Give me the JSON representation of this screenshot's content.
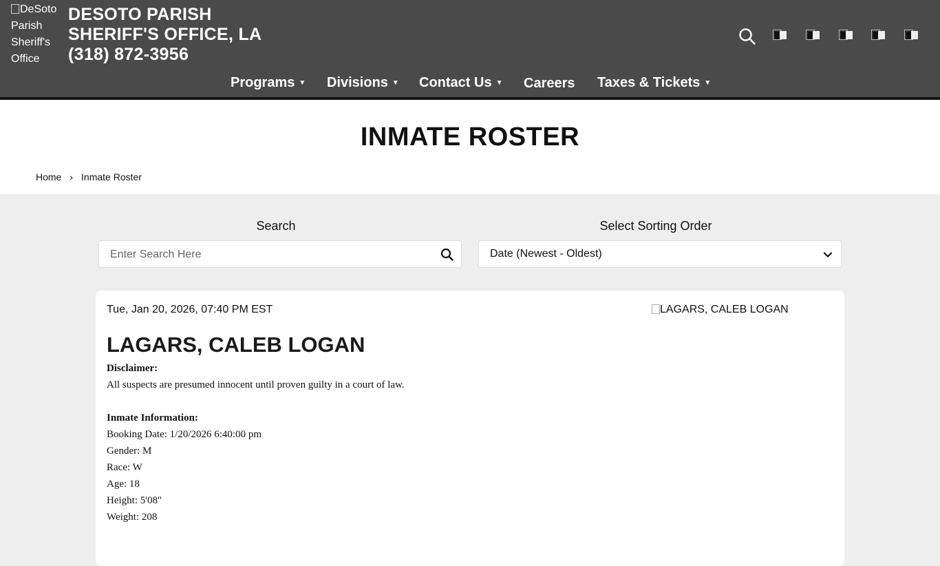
{
  "header": {
    "logo_alt": "DeSoto Parish Sheriff's Office",
    "title_lines": [
      "DESOTO PARISH",
      "SHERIFF'S OFFICE, LA",
      "(318) 872-3956"
    ],
    "social_icons": [
      "social-icon-1",
      "social-icon-2",
      "social-icon-3",
      "social-icon-4",
      "social-icon-5"
    ]
  },
  "nav": {
    "items": [
      {
        "label": "Programs",
        "has_dropdown": true
      },
      {
        "label": "Divisions",
        "has_dropdown": true
      },
      {
        "label": "Contact Us",
        "has_dropdown": true
      },
      {
        "label": "Careers",
        "has_dropdown": false
      },
      {
        "label": "Taxes & Tickets",
        "has_dropdown": true
      }
    ],
    "caret": "▼"
  },
  "page": {
    "title": "INMATE ROSTER",
    "breadcrumb": {
      "home": "Home",
      "separator": "›",
      "current": "Inmate Roster"
    }
  },
  "filters": {
    "search_label": "Search",
    "search_placeholder": "Enter Search Here",
    "sort_label": "Select Sorting Order",
    "sort_value": "Date (Newest - Oldest)"
  },
  "inmate": {
    "date": "Tue, Jan 20, 2026, 07:40 PM EST",
    "photo_alt": "LAGARS, CALEB LOGAN",
    "name": "LAGARS, CALEB LOGAN",
    "disclaimer_label": "Disclaimer:",
    "disclaimer_text": "All suspects are presumed innocent until proven guilty in a court of law.",
    "info_label": "Inmate Information:",
    "booking_date": "Booking Date: 1/20/2026 6:40:00 pm",
    "gender": "Gender: M",
    "race": "Race: W",
    "age": "Age: 18",
    "height": "Height: 5'08\"",
    "weight": "Weight: 208"
  },
  "colors": {
    "header_bg": "#4a4a4a",
    "page_bg": "#eeeeee",
    "card_bg": "#ffffff"
  }
}
